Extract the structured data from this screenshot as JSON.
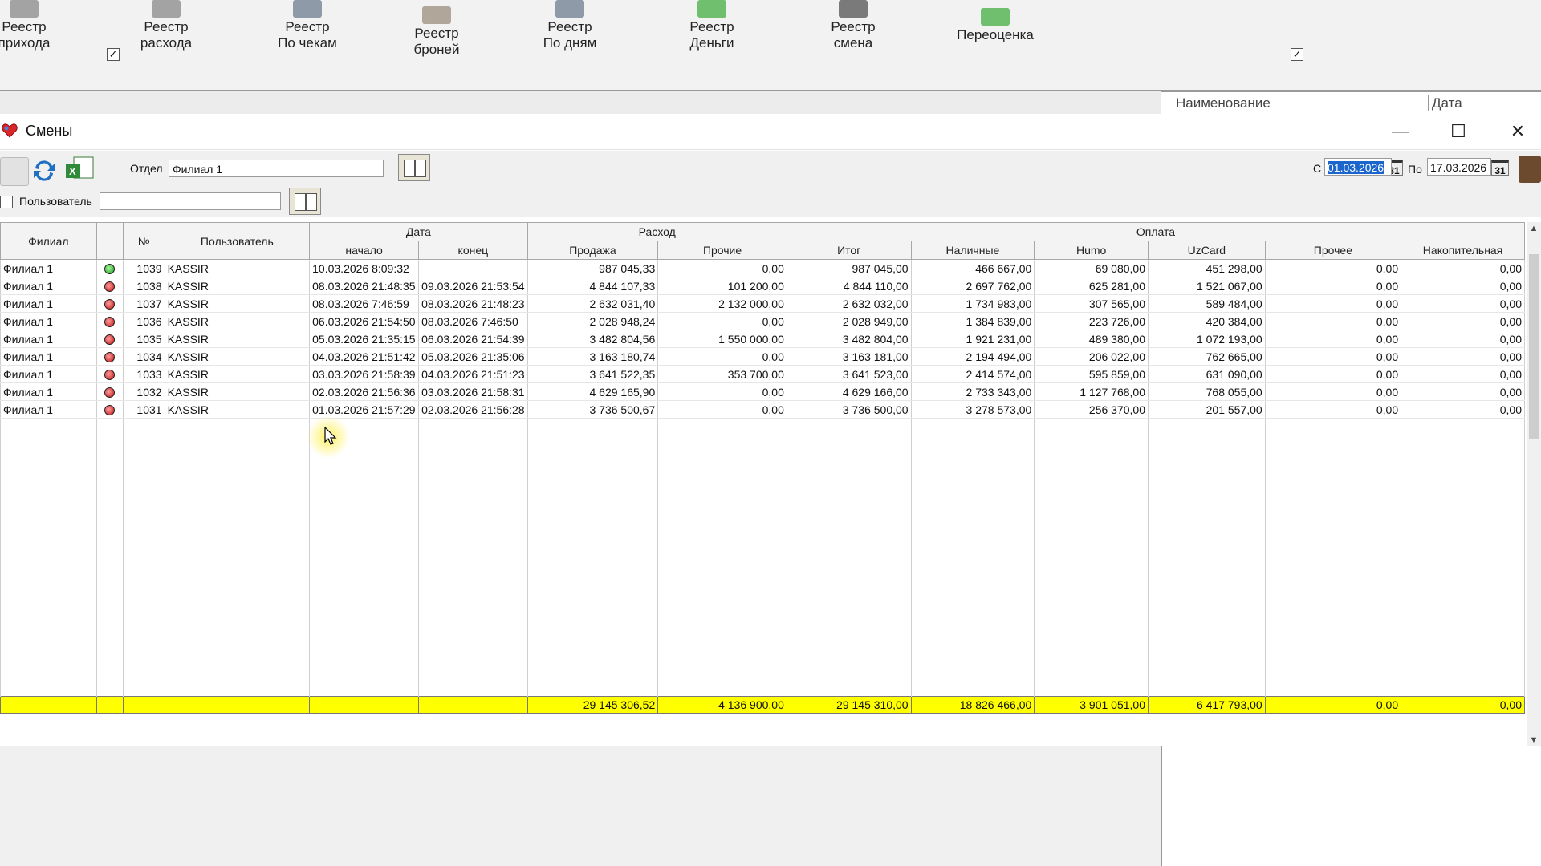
{
  "ribbon": {
    "items": [
      {
        "l1": "Реестр",
        "l2": "прихода",
        "color": "#a3a3a3"
      },
      {
        "l1": "Реестр",
        "l2": "расхода",
        "color": "#a3a3a3"
      },
      {
        "l1": "Реестр",
        "l2": "По чекам",
        "color": "#8f9aa8"
      },
      {
        "l1": "Реестр",
        "l2": "броней",
        "color": "#b0a79a"
      },
      {
        "l1": "Реестр",
        "l2": "По дням",
        "color": "#8f9aa8"
      },
      {
        "l1": "Реестр",
        "l2": "Деньги",
        "color": "#6fbf6f"
      },
      {
        "l1": "Реестр",
        "l2": "смена",
        "color": "#7a7a7a"
      },
      {
        "l1": "Переоценка",
        "l2": "",
        "color": "#6fbf6f"
      }
    ]
  },
  "behind": {
    "col1": "Наименование",
    "col2": "Дата"
  },
  "window": {
    "title": "Смены",
    "minimize": "—",
    "maximize": "☐",
    "close": "✕"
  },
  "filters": {
    "otdel_checked": "✓",
    "otdel_label": "Отдел",
    "otdel_value": "Филиал 1",
    "user_checked": "",
    "user_label": "Пользователь",
    "user_value": "",
    "date_checked": "✓",
    "from_label": "С",
    "from_value": "01.03.2026",
    "to_label": "По",
    "to_value": "17.03.2026",
    "cal_label": "31"
  },
  "grid": {
    "headers": {
      "filial": "Филиал",
      "status": "",
      "num": "№",
      "user": "Пользователь",
      "date_group": "Дата",
      "start": "начало",
      "end": "конец",
      "expense_group": "Расход",
      "sale": "Продажа",
      "other_exp": "Прочие",
      "pay_group": "Оплата",
      "total": "Итог",
      "cash": "Наличные",
      "humo": "Humo",
      "uzcard": "UzCard",
      "other_pay": "Прочее",
      "cumulative": "Накопительная"
    },
    "rows": [
      {
        "filial": "Филиал 1",
        "status": "green",
        "num": "1039",
        "user": "KASSIR",
        "start": "10.03.2026 8:09:32",
        "end": "",
        "sale": "987 045,33",
        "other_exp": "0,00",
        "total": "987 045,00",
        "cash": "466 667,00",
        "humo": "69 080,00",
        "uzcard": "451 298,00",
        "other_pay": "0,00",
        "cumulative": "0,00"
      },
      {
        "filial": "Филиал 1",
        "status": "red",
        "num": "1038",
        "user": "KASSIR",
        "start": "08.03.2026 21:48:35",
        "end": "09.03.2026 21:53:54",
        "sale": "4 844 107,33",
        "other_exp": "101 200,00",
        "total": "4 844 110,00",
        "cash": "2 697 762,00",
        "humo": "625 281,00",
        "uzcard": "1 521 067,00",
        "other_pay": "0,00",
        "cumulative": "0,00"
      },
      {
        "filial": "Филиал 1",
        "status": "red",
        "num": "1037",
        "user": "KASSIR",
        "start": "08.03.2026 7:46:59",
        "end": "08.03.2026 21:48:23",
        "sale": "2 632 031,40",
        "other_exp": "2 132 000,00",
        "total": "2 632 032,00",
        "cash": "1 734 983,00",
        "humo": "307 565,00",
        "uzcard": "589 484,00",
        "other_pay": "0,00",
        "cumulative": "0,00"
      },
      {
        "filial": "Филиал 1",
        "status": "red",
        "num": "1036",
        "user": "KASSIR",
        "start": "06.03.2026 21:54:50",
        "end": "08.03.2026 7:46:50",
        "sale": "2 028 948,24",
        "other_exp": "0,00",
        "total": "2 028 949,00",
        "cash": "1 384 839,00",
        "humo": "223 726,00",
        "uzcard": "420 384,00",
        "other_pay": "0,00",
        "cumulative": "0,00"
      },
      {
        "filial": "Филиал 1",
        "status": "red",
        "num": "1035",
        "user": "KASSIR",
        "start": "05.03.2026 21:35:15",
        "end": "06.03.2026 21:54:39",
        "sale": "3 482 804,56",
        "other_exp": "1 550 000,00",
        "total": "3 482 804,00",
        "cash": "1 921 231,00",
        "humo": "489 380,00",
        "uzcard": "1 072 193,00",
        "other_pay": "0,00",
        "cumulative": "0,00"
      },
      {
        "filial": "Филиал 1",
        "status": "red",
        "num": "1034",
        "user": "KASSIR",
        "start": "04.03.2026 21:51:42",
        "end": "05.03.2026 21:35:06",
        "sale": "3 163 180,74",
        "other_exp": "0,00",
        "total": "3 163 181,00",
        "cash": "2 194 494,00",
        "humo": "206 022,00",
        "uzcard": "762 665,00",
        "other_pay": "0,00",
        "cumulative": "0,00"
      },
      {
        "filial": "Филиал 1",
        "status": "red",
        "num": "1033",
        "user": "KASSIR",
        "start": "03.03.2026 21:58:39",
        "end": "04.03.2026 21:51:23",
        "sale": "3 641 522,35",
        "other_exp": "353 700,00",
        "total": "3 641 523,00",
        "cash": "2 414 574,00",
        "humo": "595 859,00",
        "uzcard": "631 090,00",
        "other_pay": "0,00",
        "cumulative": "0,00"
      },
      {
        "filial": "Филиал 1",
        "status": "red",
        "num": "1032",
        "user": "KASSIR",
        "start": "02.03.2026 21:56:36",
        "end": "03.03.2026 21:58:31",
        "sale": "4 629 165,90",
        "other_exp": "0,00",
        "total": "4 629 166,00",
        "cash": "2 733 343,00",
        "humo": "1 127 768,00",
        "uzcard": "768 055,00",
        "other_pay": "0,00",
        "cumulative": "0,00"
      },
      {
        "filial": "Филиал 1",
        "status": "red",
        "num": "1031",
        "user": "KASSIR",
        "start": "01.03.2026 21:57:29",
        "end": "02.03.2026 21:56:28",
        "sale": "3 736 500,67",
        "other_exp": "0,00",
        "total": "3 736 500,00",
        "cash": "3 278 573,00",
        "humo": "256 370,00",
        "uzcard": "201 557,00",
        "other_pay": "0,00",
        "cumulative": "0,00"
      }
    ],
    "totals": {
      "sale": "29 145 306,52",
      "other_exp": "4 136 900,00",
      "total": "29 145 310,00",
      "cash": "18 826 466,00",
      "humo": "3 901 051,00",
      "uzcard": "6 417 793,00",
      "other_pay": "0,00",
      "cumulative": "0,00"
    }
  },
  "scroll": {
    "up": "▲",
    "down": "▼"
  }
}
